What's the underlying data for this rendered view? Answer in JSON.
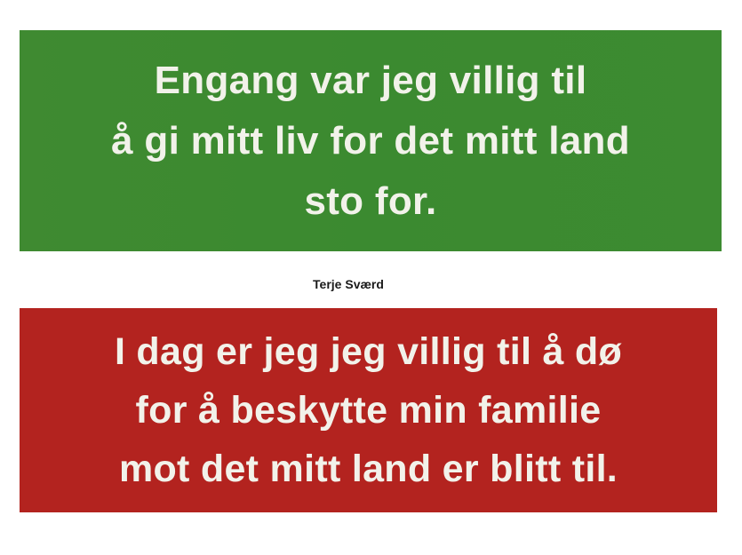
{
  "top_banner": {
    "color": "#3d8b31",
    "lines": [
      "Engang var jeg villig til",
      "å gi mitt liv for det mitt land",
      "sto for."
    ]
  },
  "caption": "Terje Sværd",
  "bottom_banner": {
    "color": "#b3231f",
    "lines": [
      "I dag er jeg jeg villig til å dø",
      "for å beskytte min familie",
      "mot det mitt land er blitt til."
    ]
  }
}
